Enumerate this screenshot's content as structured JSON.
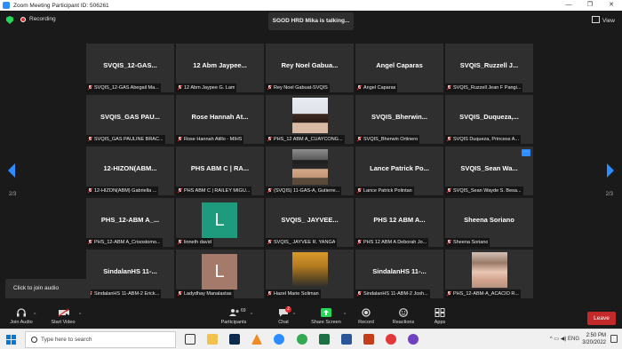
{
  "window": {
    "title": "Zoom Meeting Participant ID: 506261",
    "controls": [
      "—",
      "❐",
      "✕"
    ]
  },
  "meeting": {
    "recording_label": "Recording",
    "talking_indicator": "SGOD HRD Mika is talking...",
    "view_label": "View",
    "page_indicator": "2/3",
    "tooltip": "Click to join audio"
  },
  "tiles": [
    {
      "big": "SVQIS_12-GAS...",
      "sub": "SVQIS_12-GAS Abegail Ma..."
    },
    {
      "big": "12 Abm Jaypee...",
      "sub": "12 Abm Jaypee G. Lam"
    },
    {
      "big": "Rey Noel Gabua...",
      "sub": "Rey Noel Gabuat-SVQIS"
    },
    {
      "big": "Angel Caparas",
      "sub": "Angel Caparas"
    },
    {
      "big": "SVQIS_Ruzzell J...",
      "sub": "SVQIS_Ruzzell Jean F Pangi..."
    },
    {
      "big": "SVQIS_GAS PAU...",
      "sub": "SVQIS_GAS PAULINE BRAC..."
    },
    {
      "big": "Rose Hannah At...",
      "sub": "Rose Hannah Atillo - MIHS"
    },
    {
      "big": "",
      "sub": "PHS_12 ABM A_CUAYCONG..."
    },
    {
      "big": "SVQIS_Bherwin...",
      "sub": "SVQIS_Bherwin Ortinero"
    },
    {
      "big": "SVQIS_Duqueza,...",
      "sub": "SVQIS Duqueza, Princess A..."
    },
    {
      "big": "12-HIZON(ABM...",
      "sub": "12-HIZON(ABM) Gabriella ..."
    },
    {
      "big": "PHS ABM C | RA...",
      "sub": "PHS ABM C | RAILEY MIGU..."
    },
    {
      "big": "",
      "sub": "(SVQIS) 11-GAS-A, Gutierre..."
    },
    {
      "big": "Lance Patrick Po...",
      "sub": "Lance Patrick Polintan"
    },
    {
      "big": "SVQIS_Sean Wa...",
      "sub": "SVQIS_Sean Wayde S. Besa..."
    },
    {
      "big": "PHS_12-ABM A_...",
      "sub": "PHS_12-ABM A_Crisostomo..."
    },
    {
      "big": "",
      "sub": "linneth david",
      "avatar": "L",
      "avatar_color": "#1e9b7c"
    },
    {
      "big": "SVQIS_ JAYVEE...",
      "sub": "SVQIS_ JAYVEE R. YANGA"
    },
    {
      "big": "PHS 12 ABM A...",
      "sub": "PHS 12 ABM A Deborah Jo..."
    },
    {
      "big": "Sheena Soriano",
      "sub": "Sheena Soriano"
    },
    {
      "big": "SindalanHS 11-...",
      "sub": "SindalanHS 11-ABM-2 Erick..."
    },
    {
      "big": "",
      "sub": "Ladydhay Manalastas",
      "avatar": "L",
      "avatar_color": "#a47b6a"
    },
    {
      "big": "",
      "sub": "Hazel Marie Soliman"
    },
    {
      "big": "SindalanHS 11-...",
      "sub": "SindalanHS 11-ABM-2 Josh..."
    },
    {
      "big": "",
      "sub": "PHS_12-ABM-A_ACACIO R..."
    }
  ],
  "toolbar": {
    "join_audio": "Join Audio",
    "start_video": "Start Video",
    "participants": "Participants",
    "participants_count": "69",
    "chat": "Chat",
    "chat_badge": "2",
    "share_screen": "Share Screen",
    "record": "Record",
    "reactions": "Reactions",
    "apps": "Apps",
    "leave": "Leave"
  },
  "taskbar": {
    "search_placeholder": "Type here to search",
    "time": "2:50 PM",
    "date": "3/20/2022"
  },
  "colors": {
    "accent": "#2d8cff",
    "leave": "#c22a2a",
    "share": "#23d959"
  }
}
